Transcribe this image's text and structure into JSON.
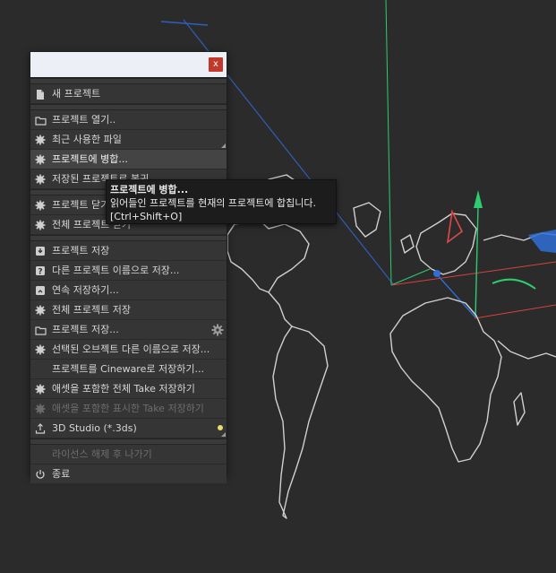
{
  "window": {
    "close_label": "x"
  },
  "menu": {
    "groups": [
      [
        {
          "label": "새 프로젝트",
          "icon": "new-document-icon"
        }
      ],
      [
        {
          "label": "프로젝트 열기..",
          "icon": "folder-icon"
        },
        {
          "label": "최근 사용한 파일",
          "icon": "gear-dot-icon",
          "submenu": true
        },
        {
          "label": "프로젝트에 병합...",
          "icon": "gear-dot-icon",
          "hover": true
        },
        {
          "label": "저장된 프로젝트로 복귀",
          "icon": "gear-dot-icon"
        }
      ],
      [
        {
          "label": "프로젝트 닫기",
          "icon": "gear-dot-icon"
        },
        {
          "label": "전체 프로젝트 닫기",
          "icon": "gear-dot-icon"
        }
      ],
      [
        {
          "label": "프로젝트 저장",
          "icon": "save-download-icon"
        },
        {
          "label": "다른 프로젝트 이름으로 저장...",
          "icon": "save-as-question-icon"
        },
        {
          "label": "연속 저장하기...",
          "icon": "save-incremental-icon"
        },
        {
          "label": "전체 프로젝트 저장",
          "icon": "save-all-icon"
        },
        {
          "label": "프로젝트 저장...",
          "icon": "folder-icon",
          "gear": true
        },
        {
          "label": "선택된 오브젝트 다른 이름으로 저장...",
          "icon": "gear-dot-icon"
        },
        {
          "label": "프로젝트를 Cineware로 저장하기...",
          "icon": ""
        },
        {
          "label": "애셋을 포함한 전체 Take  저장하기",
          "icon": "gear-dot-icon"
        },
        {
          "label": "애셋을 포함한 표시한 Take 저장하기",
          "icon": "gear-dot-icon",
          "disabled": true
        },
        {
          "label": "3D Studio (*.3ds)",
          "icon": "export-upload-icon",
          "submenu": true,
          "dot": true
        }
      ],
      [
        {
          "label": "라이선스 해제 후 나가기",
          "icon": "",
          "disabled": true
        },
        {
          "label": "종료",
          "icon": "power-icon"
        }
      ]
    ]
  },
  "tooltip": {
    "title": "프로젝트에 병합...",
    "description": "읽어들인 프로젝트를 현재의 프로젝트에 합칩니다.",
    "shortcut": "[Ctrl+Shift+O]"
  },
  "colors": {
    "background": "#2b2b2b",
    "menu_bg": "#353535",
    "close_red": "#c0392b",
    "axis_green": "#2ecc71",
    "axis_red": "#e74c3c",
    "axis_blue": "#2f6fd6",
    "map_outline": "#cfcfcf"
  }
}
